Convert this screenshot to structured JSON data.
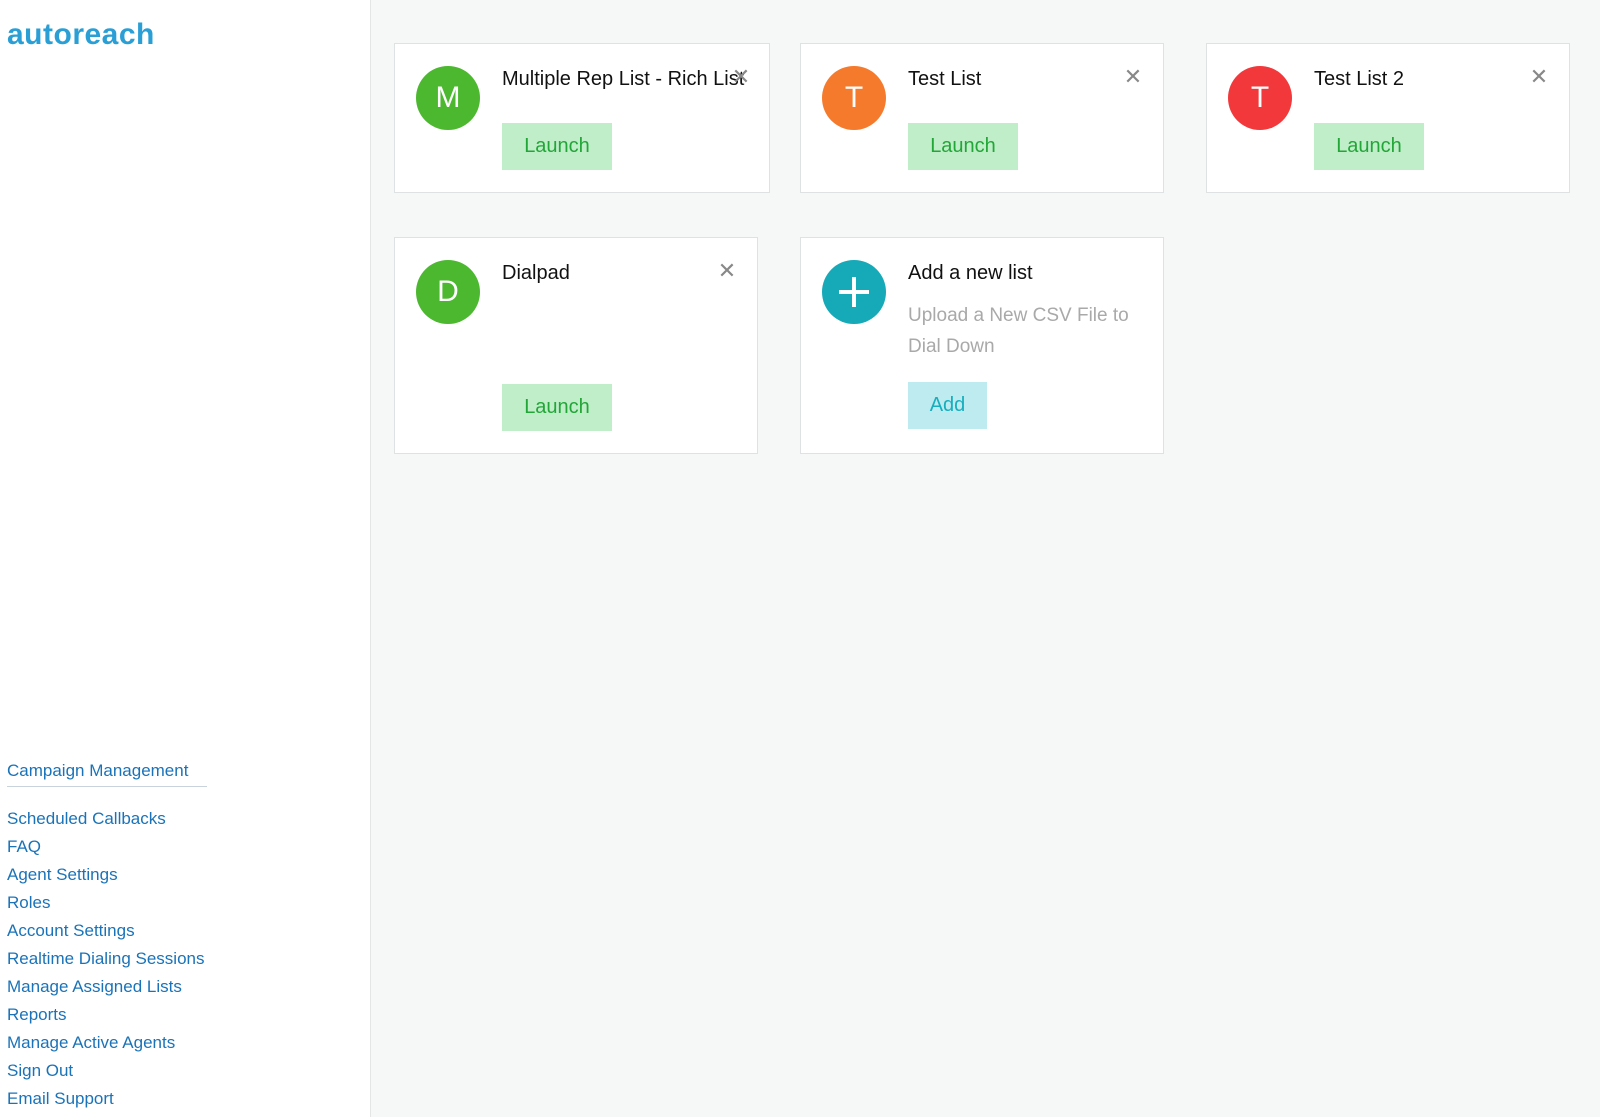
{
  "brand": {
    "logo_text": "autoreach"
  },
  "sidebar": {
    "primary_link": "Campaign Management",
    "links": [
      "Scheduled Callbacks",
      "FAQ",
      "Agent Settings",
      "Roles",
      "Account Settings",
      "Realtime Dialing Sessions",
      "Manage Assigned Lists",
      "Reports",
      "Manage Active Agents",
      "Sign Out",
      "Email Support"
    ]
  },
  "lists": [
    {
      "initial": "M",
      "title": "Multiple Rep List - Rich List",
      "launch_label": "Launch",
      "close_icon": "close-icon",
      "color": "#4cb82f"
    },
    {
      "initial": "T",
      "title": "Test List",
      "launch_label": "Launch",
      "close_icon": "close-icon",
      "color": "#f57a2c"
    },
    {
      "initial": "T",
      "title": "Test List 2",
      "launch_label": "Launch",
      "close_icon": "close-icon",
      "color": "#f2383a"
    },
    {
      "initial": "D",
      "title": "Dialpad",
      "launch_label": "Launch",
      "close_icon": "close-icon",
      "color": "#4cb82f"
    }
  ],
  "add_card": {
    "icon": "plus-icon",
    "title": "Add a new list",
    "description": "Upload a New CSV File to Dial Down",
    "button_label": "Add",
    "color": "#16a9b8"
  },
  "colors": {
    "link": "#1a73b8",
    "launch_bg": "#bfeec9",
    "launch_text": "#23a638",
    "add_bg": "#bdebf0",
    "add_text": "#17aebd"
  }
}
